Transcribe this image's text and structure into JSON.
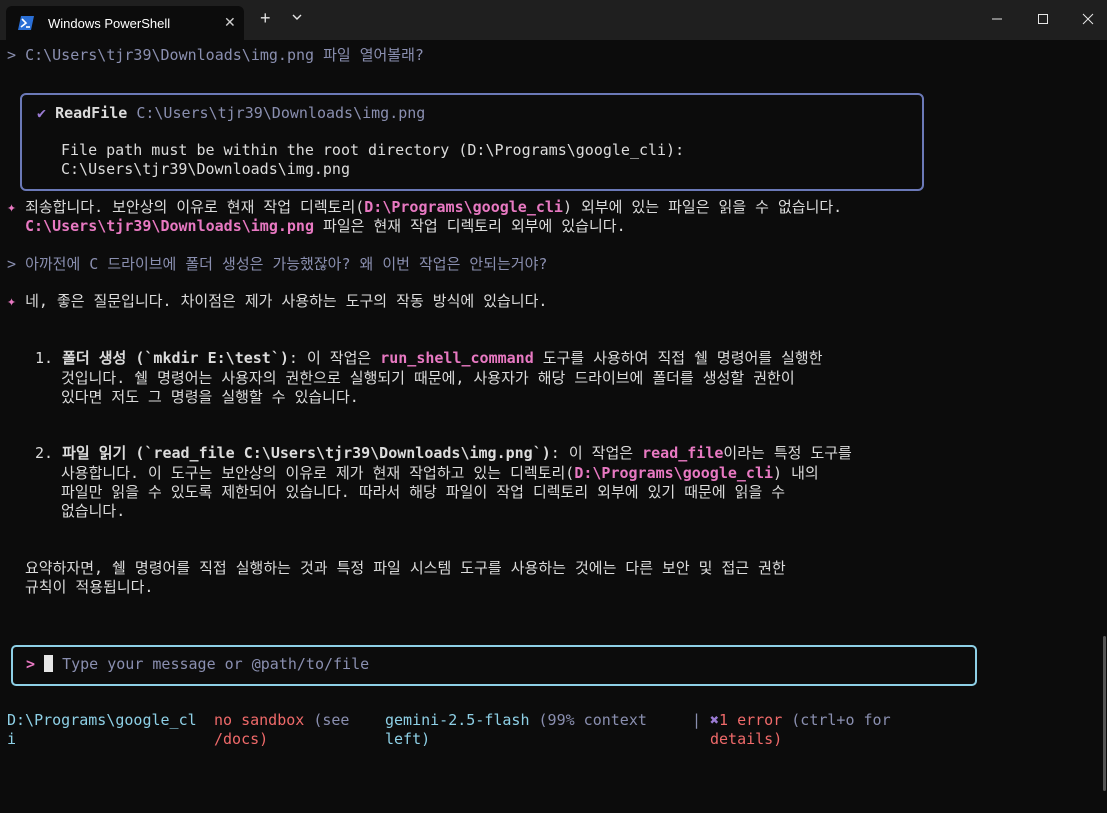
{
  "window": {
    "tab_title": "Windows PowerShell",
    "tab_close": "✕",
    "new_tab": "+",
    "dropdown_icon": "chevron-down-icon",
    "minimize_icon": "minimize-icon",
    "maximize_icon": "maximize-icon",
    "close_icon": "close-icon"
  },
  "conversation": {
    "prompt1_marker": ">",
    "prompt1_text": "C:\\Users\\tjr39\\Downloads\\img.png 파일 열어볼래?",
    "tool": {
      "check": "✔",
      "name": "ReadFile",
      "path": "C:\\Users\\tjr39\\Downloads\\img.png",
      "error_line1": "File path must be within the root directory (D:\\Programs\\google_cli):",
      "error_line2": "C:\\Users\\tjr39\\Downloads\\img.png"
    },
    "reply1": {
      "marker": "✦",
      "seg1": "죄송합니다. 보안상의 이유로 현재 작업 디렉토리(",
      "seg2": "D:\\Programs\\google_cli",
      "seg3": ") 외부에 있는 파일은 읽을 수 없습니다.",
      "seg4": "C:\\Users\\tjr39\\Downloads\\img.png",
      "seg5": " 파일은 현재 작업 디렉토리 외부에 있습니다."
    },
    "prompt2_marker": ">",
    "prompt2_text": "아까전에 C 드라이브에 폴더 생성은 가능했잖아? 왜 이번 작업은 안되는거야?",
    "reply2": {
      "marker": "✦",
      "intro": "네, 좋은 질문입니다. 차이점은 제가 사용하는 도구의 작동 방식에 있습니다.",
      "item1": {
        "num": "1.",
        "bold": "폴더 생성 (`mkdir E:\\test`)",
        "seg1": ": 이 작업은 ",
        "tool": "run_shell_command",
        "seg2": " 도구를 사용하여 직접 쉘 명령어를 실행한",
        "line2": "것입니다. 쉘 명령어는 사용자의 권한으로 실행되기 때문에, 사용자가 해당 드라이브에 폴더를 생성할 권한이",
        "line3": "있다면 저도 그 명령을 실행할 수 있습니다."
      },
      "item2": {
        "num": "2.",
        "bold": "파일 읽기 (`read_file C:\\Users\\tjr39\\Downloads\\img.png`)",
        "seg1": ": 이 작업은 ",
        "tool": "read_file",
        "seg2": "이라는 특정 도구를",
        "line2a": "사용합니다. 이 도구는 보안상의 이유로 제가 현재 작업하고 있는 디렉토리(",
        "line2b": "D:\\Programs\\google_cli",
        "line2c": ") 내의",
        "line3": "파일만 읽을 수 있도록 제한되어 있습니다. 따라서 해당 파일이 작업 디렉토리 외부에 있기 때문에 읽을 수",
        "line4": "없습니다."
      },
      "summary_line1": "요약하자면, 쉘 명령어를 직접 실행하는 것과 특정 파일 시스템 도구를 사용하는 것에는 다른 보안 및 접근 권한",
      "summary_line2": "규칙이 적용됩니다."
    }
  },
  "input": {
    "marker": ">",
    "placeholder": "Type your message or @path/to/file"
  },
  "status": {
    "cwd_line1": "D:\\Programs\\google_cl",
    "cwd_line2": "i",
    "sandbox_a": "no sandbox",
    "sandbox_b": " (see",
    "sandbox_line2": "/docs)",
    "model": "gemini-2.5-flash",
    "context": " (99% context",
    "context_line2": "left)",
    "separator": "|",
    "error_icon": "✖",
    "error_count": "1 error",
    "error_hint": " (ctrl+o for",
    "error_hint_line2": "details)"
  },
  "colors": {
    "background": "#0c0c0c",
    "pink": "#e879c2",
    "purple": "#9b7bd4",
    "grey": "#8a8fb0",
    "border_tool": "#6b79b8",
    "border_input": "#8ed0e6",
    "red": "#f06a6a"
  }
}
